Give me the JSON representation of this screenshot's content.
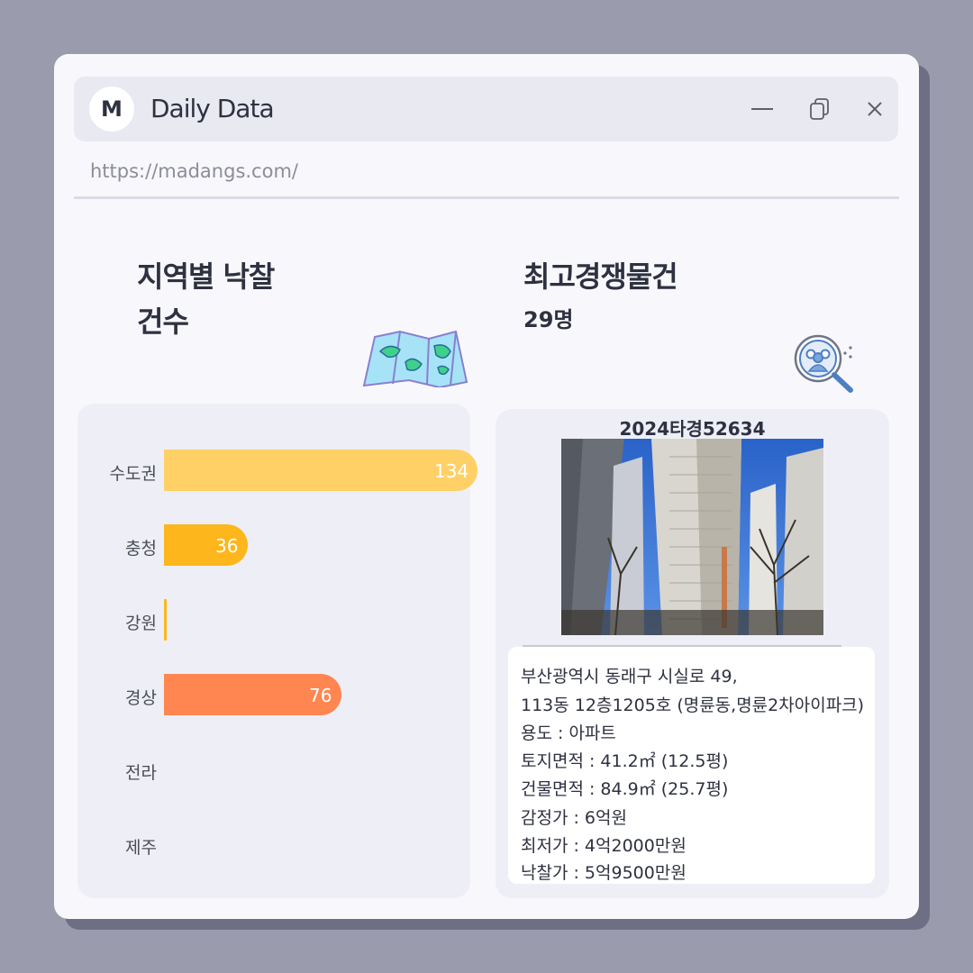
{
  "window": {
    "logo_letter": "M",
    "title": "Daily Data",
    "url": "https://madangs.com/",
    "controls": [
      "minimize-icon",
      "restore-icon",
      "close-icon"
    ]
  },
  "left": {
    "heading_line1": "지역별 낙찰",
    "heading_line2": "건수",
    "icon": "map-icon"
  },
  "right": {
    "heading": "최고경쟁물건",
    "bidders": "29명",
    "icon": "people-search-icon"
  },
  "chart_data": {
    "type": "bar",
    "orientation": "horizontal",
    "categories": [
      "수도권",
      "충청",
      "강원",
      "경상",
      "전라",
      "제주"
    ],
    "values": [
      134,
      36,
      1,
      76,
      0,
      0
    ],
    "data_labels": [
      "134",
      "36",
      "",
      "76",
      "",
      ""
    ],
    "colors": [
      "#ffd066",
      "#fdb61c",
      "#fdb61c",
      "#ff8650",
      "#ff8650",
      "#ff8650"
    ],
    "xlim": [
      0,
      134
    ]
  },
  "property": {
    "case_no": "2024타경52634",
    "address_line1": "부산광역시 동래구 시실로 49,",
    "address_line2": "113동 12층1205호 (명륜동,명륜2차아이파크)",
    "usage": "용도 : 아파트",
    "land_area": "토지면적 : 41.2㎡ (12.5평)",
    "building_area": "건물면적 : 84.9㎡ (25.7평)",
    "appraisal": "감정가 : 6억원",
    "minimum": "최저가 : 4억2000만원",
    "winning_bid": "낙찰가 : 5억9500만원"
  }
}
